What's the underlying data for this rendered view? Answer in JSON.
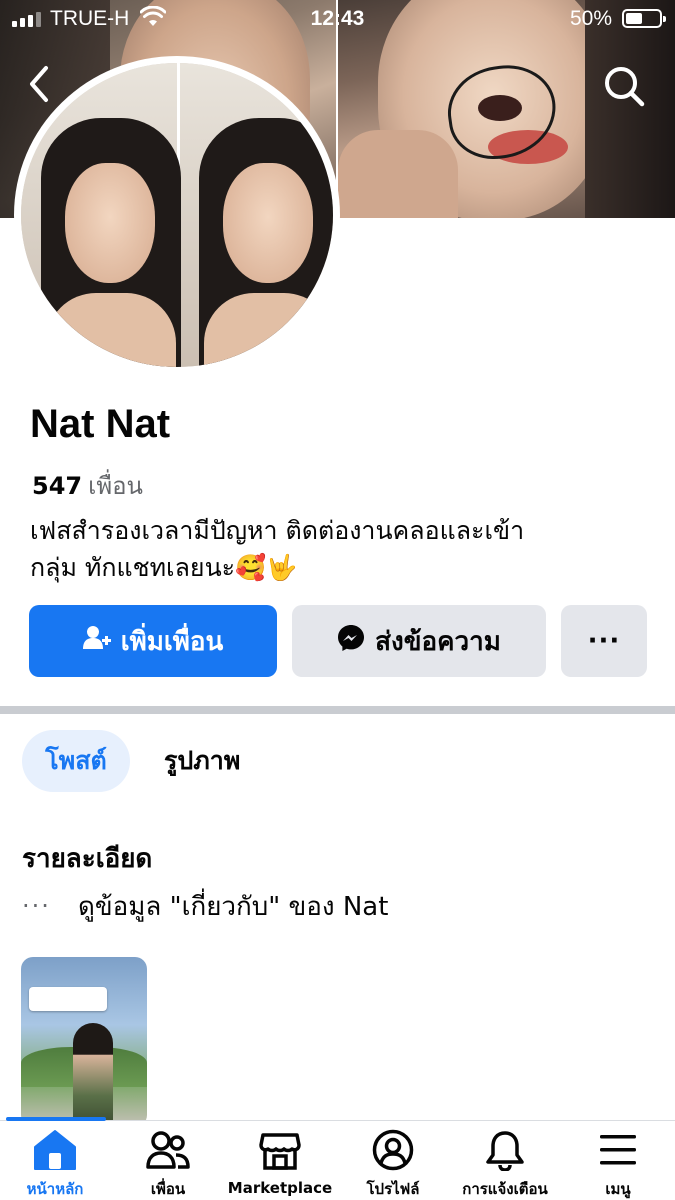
{
  "status_bar": {
    "carrier": "TRUE-H",
    "time": "12:43",
    "battery_percent": "50%",
    "battery_level": 0.5,
    "signal_icon": "signal-bars-icon",
    "wifi_icon": "wifi-icon"
  },
  "header": {
    "back_icon": "chevron-left-icon",
    "search_icon": "search-icon"
  },
  "profile": {
    "name": "Nat Nat",
    "friend_count": "547",
    "friends_label": "เพื่อน",
    "bio_line1": "เฟสสำรองเวลามีปัญหา ติดต่องานคลอและเข้า",
    "bio_line2": "กลุ่ม ทักแชทเลยนะ🥰🤟"
  },
  "actions": {
    "add_friend": "เพิ่มเพื่อน",
    "message": "ส่งข้อความ",
    "more": "···"
  },
  "tabs": [
    {
      "label": "โพสต์",
      "active": true
    },
    {
      "label": "รูปภาพ",
      "active": false
    }
  ],
  "details": {
    "title": "รายละเอียด",
    "about_dots": "···",
    "about_link": "ดูข้อมูล \"เกี่ยวกับ\" ของ Nat"
  },
  "bottom_nav": [
    {
      "label": "หน้าหลัก",
      "icon": "home-icon",
      "active": true
    },
    {
      "label": "เพื่อน",
      "icon": "friends-icon",
      "active": false
    },
    {
      "label": "Marketplace",
      "icon": "marketplace-icon",
      "active": false
    },
    {
      "label": "โปรไฟล์",
      "icon": "profile-icon",
      "active": false
    },
    {
      "label": "การแจ้งเตือน",
      "icon": "bell-icon",
      "active": false
    },
    {
      "label": "เมนู",
      "icon": "menu-icon",
      "active": false
    }
  ],
  "colors": {
    "accent": "#1877f2",
    "secondary_button": "#e4e6eb",
    "muted_text": "#65676b"
  }
}
